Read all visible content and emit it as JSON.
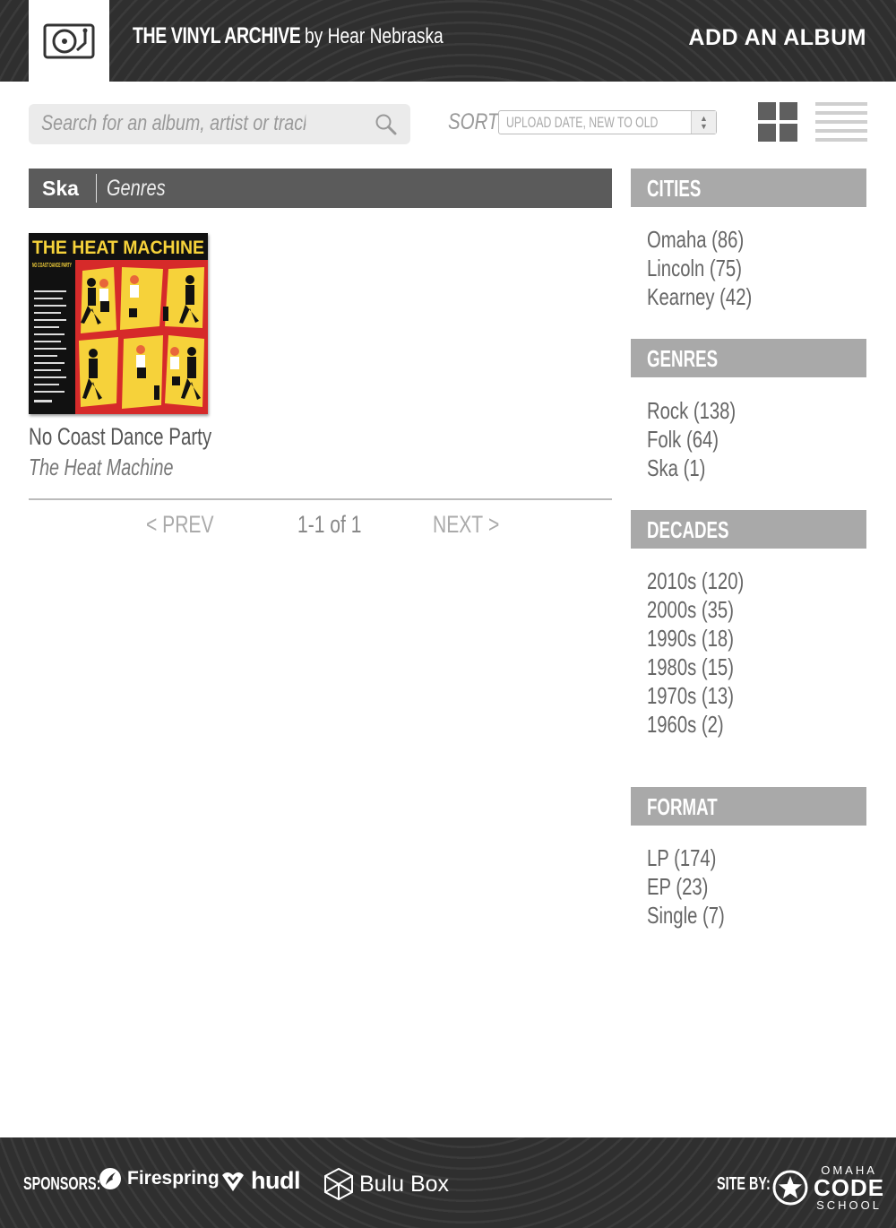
{
  "header": {
    "site_name": "THE VINYL ARCHIVE",
    "byline": "by Hear Nebraska",
    "add_album": "ADD AN ALBUM"
  },
  "toolbar": {
    "search_placeholder": "Search for an album, artist or track...",
    "sort_label": "SORT",
    "sort_value": "UPLOAD DATE, NEW TO OLD"
  },
  "filter": {
    "current": "Ska",
    "category": "Genres"
  },
  "albums": [
    {
      "title": "No Coast Dance Party",
      "artist": "The Heat Machine",
      "cover_band_text": "THE HEAT MACHINE",
      "cover_album_text": "NO COAST DANCE PARTY"
    }
  ],
  "pager": {
    "prev": "PREV",
    "count": "1-1 of 1",
    "next": "NEXT"
  },
  "sidebar": {
    "cities": {
      "heading": "CITIES",
      "items": [
        "Omaha (86)",
        "Lincoln (75)",
        "Kearney (42)"
      ]
    },
    "genres": {
      "heading": "GENRES",
      "items": [
        "Rock (138)",
        "Folk (64)",
        "Ska (1)"
      ]
    },
    "decades": {
      "heading": "DECADES",
      "items": [
        "2010s (120)",
        "2000s (35)",
        "1990s (18)",
        "1980s (15)",
        "1970s (13)",
        "1960s (2)"
      ]
    },
    "format": {
      "heading": "FORMAT",
      "items": [
        "LP (174)",
        "EP (23)",
        "Single (7)"
      ]
    }
  },
  "footer": {
    "sponsors_label": "SPONSORS:",
    "sponsors": [
      "Firespring",
      "hudl",
      "Bulu Box"
    ],
    "site_by_label": "SITE BY:",
    "site_by": {
      "line1": "OMAHA",
      "line2": "CODE",
      "line3": "SCHOOL"
    }
  },
  "icons": {
    "logo": "turntable-icon",
    "search": "search-icon",
    "grid": "grid-view-icon",
    "list": "list-view-icon"
  },
  "colors": {
    "header_bg": "#2f2f2f",
    "filter_bar": "#5b5b5b",
    "sidebar_heading": "#a9a9a9",
    "cover_red": "#d62a2a",
    "cover_yellow": "#f6d23a"
  }
}
